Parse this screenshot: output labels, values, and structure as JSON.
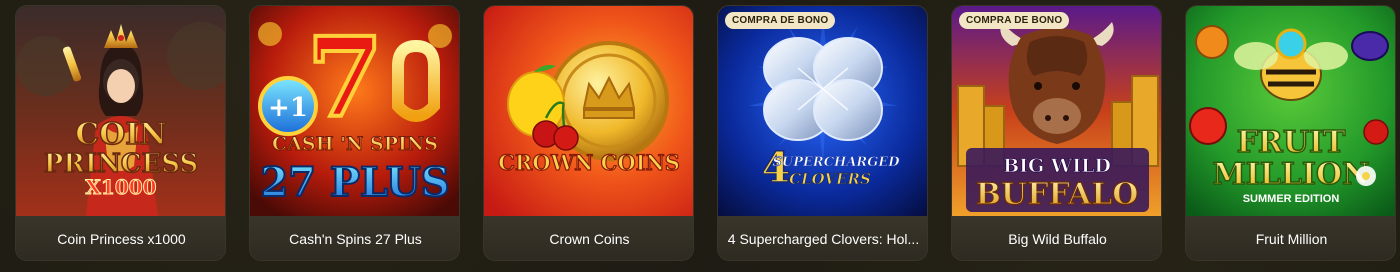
{
  "games": [
    {
      "name": "Coin Princess x1000",
      "badge": "",
      "art_title_lines": [
        "COIN",
        "PRINCESS",
        "X1000"
      ],
      "colors": {
        "bg_top": "#5b2a1c",
        "bg_bottom": "#b0411c",
        "accent": "#f6c544"
      }
    },
    {
      "name": "Cash'n Spins 27 Plus",
      "badge": "",
      "art_title_lines": [
        "+1",
        "7",
        "CASH 'N SPINS",
        "27 PLUS"
      ],
      "colors": {
        "bg_top": "#7a0d0a",
        "bg_bottom": "#ff5a12",
        "accent": "#ffd23a"
      }
    },
    {
      "name": "Crown Coins",
      "badge": "",
      "art_title_lines": [
        "CROWN COINS"
      ],
      "colors": {
        "bg_top": "#d3231a",
        "bg_bottom": "#ff8f24",
        "accent": "#f2c23a"
      }
    },
    {
      "name": "4 Supercharged Clovers: Hol...",
      "badge": "COMPRA DE BONO",
      "art_title_lines": [
        "4",
        "SUPERCHARGED",
        "CLOVERS"
      ],
      "colors": {
        "bg_top": "#0a1a5c",
        "bg_bottom": "#0a2a8c",
        "accent": "#e8c34a"
      }
    },
    {
      "name": "Big Wild Buffalo",
      "badge": "COMPRA DE BONO",
      "art_title_lines": [
        "BIG WILD",
        "BUFFALO"
      ],
      "colors": {
        "bg_top": "#6b1a7a",
        "bg_bottom": "#c4541a",
        "accent": "#f3c64a"
      }
    },
    {
      "name": "Fruit Million",
      "badge": "",
      "art_title_lines": [
        "FRUIT",
        "MILLION",
        "SUMMER EDITION"
      ],
      "colors": {
        "bg_top": "#3fa12a",
        "bg_bottom": "#0f6b1c",
        "accent": "#f6d44a"
      }
    }
  ]
}
